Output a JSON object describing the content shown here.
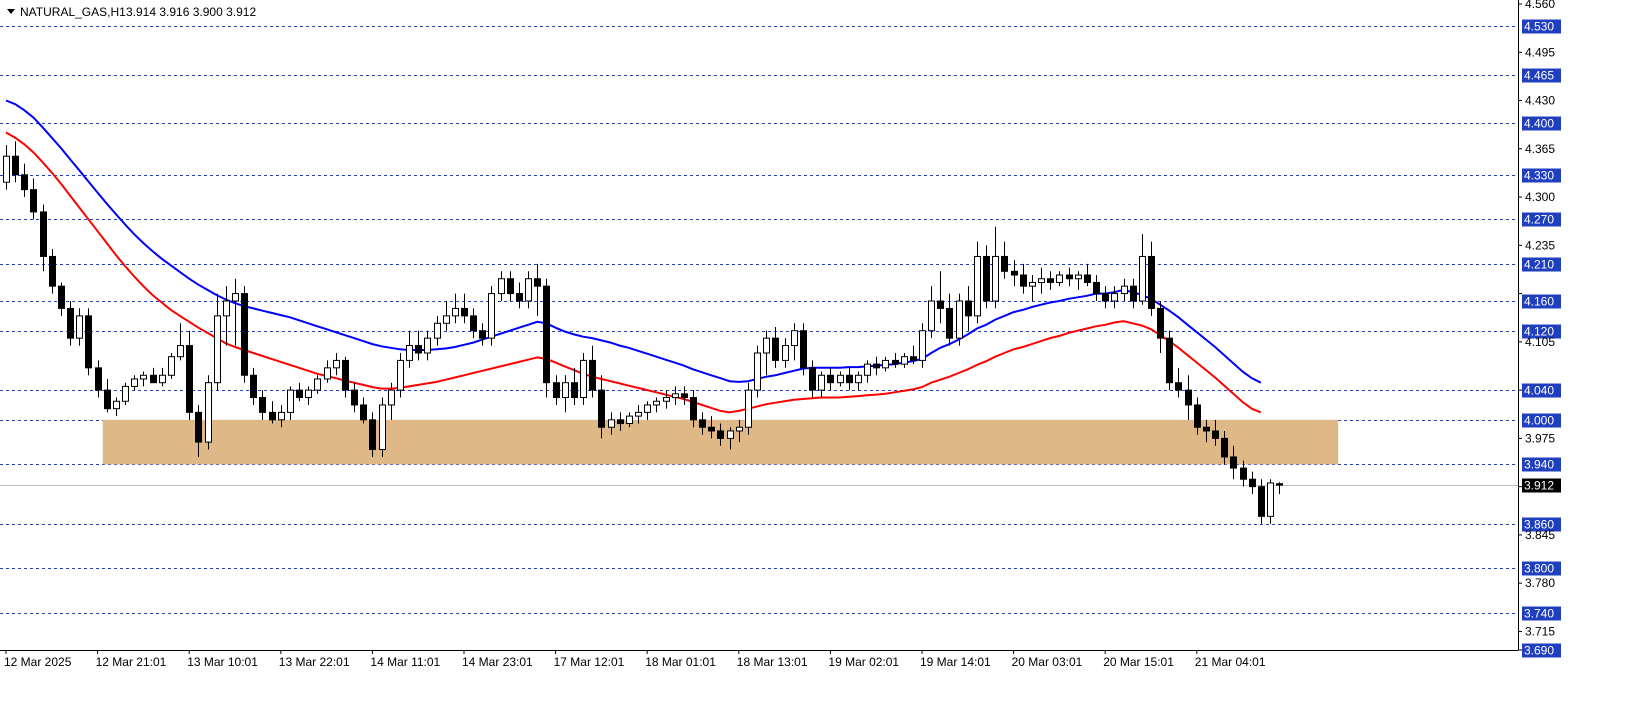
{
  "header": {
    "symbol": "NATURAL_GAS,H1",
    "ohlc": "3.914 3.916 3.900 3.912"
  },
  "colors": {
    "background": "#ffffff",
    "grid_level": "#1f3fbf",
    "badge": "#1f3fbf",
    "zone": "#deb887",
    "ma_fast": "#ff0000",
    "ma_slow": "#0000ff",
    "current_badge": "#000000"
  },
  "chart_data": {
    "type": "candlestick",
    "ylim": [
      3.69,
      4.56
    ],
    "y_ticks": [
      "4.560",
      "4.495",
      "4.430",
      "4.365",
      "4.300",
      "4.235",
      "4.170",
      "4.105",
      "4.040",
      "3.975",
      "3.910",
      "3.845",
      "3.780",
      "3.715",
      "3.690"
    ],
    "levels": [
      "4.530",
      "4.465",
      "4.400",
      "4.330",
      "4.270",
      "4.210",
      "4.160",
      "4.120",
      "4.040",
      "4.000",
      "3.940",
      "3.860",
      "3.800",
      "3.740",
      "3.690"
    ],
    "current_price": "3.912",
    "zone": {
      "from_bar": 11,
      "to_bar": 145,
      "low": 3.94,
      "high": 4.0
    },
    "x_labels": [
      {
        "bar": 0,
        "label": "12 Mar 2025"
      },
      {
        "bar": 10,
        "label": "12 Mar 21:01"
      },
      {
        "bar": 20,
        "label": "13 Mar 10:01"
      },
      {
        "bar": 30,
        "label": "13 Mar 22:01"
      },
      {
        "bar": 40,
        "label": "14 Mar 11:01"
      },
      {
        "bar": 50,
        "label": "14 Mar 23:01"
      },
      {
        "bar": 60,
        "label": "17 Mar 12:01"
      },
      {
        "bar": 70,
        "label": "18 Mar 01:01"
      },
      {
        "bar": 80,
        "label": "18 Mar 13:01"
      },
      {
        "bar": 90,
        "label": "19 Mar 02:01"
      },
      {
        "bar": 100,
        "label": "19 Mar 14:01"
      },
      {
        "bar": 110,
        "label": "20 Mar 03:01"
      },
      {
        "bar": 120,
        "label": "20 Mar 15:01"
      },
      {
        "bar": 130,
        "label": "21 Mar 04:01"
      }
    ],
    "candles": [
      [
        4.32,
        4.37,
        4.31,
        4.355
      ],
      [
        4.355,
        4.375,
        4.32,
        4.33
      ],
      [
        4.33,
        4.345,
        4.3,
        4.31
      ],
      [
        4.31,
        4.325,
        4.27,
        4.28
      ],
      [
        4.28,
        4.29,
        4.2,
        4.22
      ],
      [
        4.22,
        4.23,
        4.17,
        4.18
      ],
      [
        4.18,
        4.185,
        4.14,
        4.15
      ],
      [
        4.15,
        4.16,
        4.1,
        4.11
      ],
      [
        4.11,
        4.15,
        4.1,
        4.14
      ],
      [
        4.14,
        4.15,
        4.06,
        4.07
      ],
      [
        4.07,
        4.08,
        4.03,
        4.04
      ],
      [
        4.04,
        4.055,
        4.01,
        4.015
      ],
      [
        4.015,
        4.03,
        4.005,
        4.025
      ],
      [
        4.025,
        4.05,
        4.02,
        4.045
      ],
      [
        4.045,
        4.06,
        4.04,
        4.055
      ],
      [
        4.055,
        4.065,
        4.045,
        4.06
      ],
      [
        4.06,
        4.07,
        4.05,
        4.05
      ],
      [
        4.05,
        4.07,
        4.045,
        4.06
      ],
      [
        4.06,
        4.09,
        4.055,
        4.085
      ],
      [
        4.085,
        4.13,
        4.08,
        4.1
      ],
      [
        4.1,
        4.12,
        4.0,
        4.01
      ],
      [
        4.01,
        4.02,
        3.95,
        3.97
      ],
      [
        3.97,
        4.06,
        3.96,
        4.05
      ],
      [
        4.05,
        4.17,
        4.04,
        4.14
      ],
      [
        4.14,
        4.18,
        4.1,
        4.16
      ],
      [
        4.16,
        4.19,
        4.1,
        4.17
      ],
      [
        4.17,
        4.18,
        4.05,
        4.06
      ],
      [
        4.06,
        4.07,
        4.02,
        4.03
      ],
      [
        4.03,
        4.04,
        4.0,
        4.01
      ],
      [
        4.01,
        4.025,
        3.995,
        4.0
      ],
      [
        4.0,
        4.02,
        3.99,
        4.01
      ],
      [
        4.01,
        4.045,
        4.0,
        4.04
      ],
      [
        4.04,
        4.05,
        4.025,
        4.03
      ],
      [
        4.03,
        4.045,
        4.02,
        4.04
      ],
      [
        4.04,
        4.06,
        4.035,
        4.055
      ],
      [
        4.055,
        4.08,
        4.05,
        4.07
      ],
      [
        4.07,
        4.09,
        4.06,
        4.08
      ],
      [
        4.08,
        4.085,
        4.03,
        4.04
      ],
      [
        4.04,
        4.05,
        4.01,
        4.02
      ],
      [
        4.02,
        4.03,
        3.995,
        4.0
      ],
      [
        4.0,
        4.01,
        3.95,
        3.96
      ],
      [
        3.96,
        4.03,
        3.95,
        4.02
      ],
      [
        4.02,
        4.05,
        4.0,
        4.04
      ],
      [
        4.04,
        4.09,
        4.03,
        4.08
      ],
      [
        4.08,
        4.12,
        4.07,
        4.1
      ],
      [
        4.1,
        4.12,
        4.08,
        4.09
      ],
      [
        4.09,
        4.12,
        4.08,
        4.11
      ],
      [
        4.11,
        4.14,
        4.1,
        4.13
      ],
      [
        4.13,
        4.16,
        4.12,
        4.14
      ],
      [
        4.14,
        4.17,
        4.13,
        4.15
      ],
      [
        4.15,
        4.17,
        4.13,
        4.14
      ],
      [
        4.14,
        4.15,
        4.11,
        4.12
      ],
      [
        4.12,
        4.13,
        4.1,
        4.11
      ],
      [
        4.11,
        4.18,
        4.1,
        4.17
      ],
      [
        4.17,
        4.2,
        4.16,
        4.19
      ],
      [
        4.19,
        4.2,
        4.16,
        4.17
      ],
      [
        4.17,
        4.185,
        4.15,
        4.16
      ],
      [
        4.16,
        4.2,
        4.15,
        4.19
      ],
      [
        4.19,
        4.21,
        4.14,
        4.18
      ],
      [
        4.18,
        4.19,
        4.03,
        4.05
      ],
      [
        4.05,
        4.06,
        4.02,
        4.03
      ],
      [
        4.03,
        4.06,
        4.01,
        4.05
      ],
      [
        4.05,
        4.07,
        4.02,
        4.03
      ],
      [
        4.03,
        4.09,
        4.02,
        4.08
      ],
      [
        4.08,
        4.1,
        4.03,
        4.04
      ],
      [
        4.04,
        4.06,
        3.975,
        3.99
      ],
      [
        3.99,
        4.01,
        3.98,
        4.0
      ],
      [
        4.0,
        4.01,
        3.985,
        3.995
      ],
      [
        3.995,
        4.01,
        3.99,
        4.005
      ],
      [
        4.005,
        4.02,
        3.995,
        4.01
      ],
      [
        4.01,
        4.025,
        4.0,
        4.02
      ],
      [
        4.02,
        4.03,
        4.01,
        4.025
      ],
      [
        4.025,
        4.04,
        4.015,
        4.03
      ],
      [
        4.03,
        4.045,
        4.02,
        4.035
      ],
      [
        4.035,
        4.045,
        4.02,
        4.03
      ],
      [
        4.03,
        4.04,
        3.99,
        4.0
      ],
      [
        4.0,
        4.01,
        3.98,
        3.99
      ],
      [
        3.99,
        4.005,
        3.975,
        3.985
      ],
      [
        3.985,
        3.995,
        3.965,
        3.975
      ],
      [
        3.975,
        3.99,
        3.96,
        3.985
      ],
      [
        3.985,
        4.0,
        3.97,
        3.99
      ],
      [
        3.99,
        4.05,
        3.98,
        4.04
      ],
      [
        4.04,
        4.1,
        4.03,
        4.09
      ],
      [
        4.09,
        4.12,
        4.06,
        4.11
      ],
      [
        4.11,
        4.125,
        4.07,
        4.08
      ],
      [
        4.08,
        4.11,
        4.07,
        4.1
      ],
      [
        4.1,
        4.13,
        4.08,
        4.12
      ],
      [
        4.12,
        4.13,
        4.06,
        4.07
      ],
      [
        4.07,
        4.08,
        4.03,
        4.04
      ],
      [
        4.04,
        4.065,
        4.03,
        4.06
      ],
      [
        4.06,
        4.07,
        4.04,
        4.05
      ],
      [
        4.05,
        4.065,
        4.045,
        4.06
      ],
      [
        4.06,
        4.07,
        4.04,
        4.05
      ],
      [
        4.05,
        4.065,
        4.04,
        4.06
      ],
      [
        4.06,
        4.08,
        4.05,
        4.075
      ],
      [
        4.075,
        4.085,
        4.06,
        4.07
      ],
      [
        4.07,
        4.085,
        4.065,
        4.08
      ],
      [
        4.08,
        4.09,
        4.07,
        4.075
      ],
      [
        4.075,
        4.09,
        4.07,
        4.085
      ],
      [
        4.085,
        4.1,
        4.075,
        4.08
      ],
      [
        4.08,
        4.13,
        4.07,
        4.12
      ],
      [
        4.12,
        4.18,
        4.11,
        4.16
      ],
      [
        4.16,
        4.2,
        4.13,
        4.15
      ],
      [
        4.15,
        4.17,
        4.1,
        4.11
      ],
      [
        4.11,
        4.17,
        4.1,
        4.16
      ],
      [
        4.16,
        4.18,
        4.12,
        4.14
      ],
      [
        4.14,
        4.24,
        4.13,
        4.22
      ],
      [
        4.22,
        4.235,
        4.15,
        4.16
      ],
      [
        4.16,
        4.26,
        4.15,
        4.22
      ],
      [
        4.22,
        4.24,
        4.19,
        4.2
      ],
      [
        4.2,
        4.215,
        4.18,
        4.195
      ],
      [
        4.195,
        4.21,
        4.17,
        4.18
      ],
      [
        4.18,
        4.195,
        4.16,
        4.185
      ],
      [
        4.185,
        4.205,
        4.17,
        4.19
      ],
      [
        4.19,
        4.2,
        4.175,
        4.185
      ],
      [
        4.185,
        4.2,
        4.18,
        4.195
      ],
      [
        4.195,
        4.205,
        4.18,
        4.19
      ],
      [
        4.19,
        4.2,
        4.175,
        4.195
      ],
      [
        4.195,
        4.21,
        4.18,
        4.185
      ],
      [
        4.185,
        4.195,
        4.16,
        4.17
      ],
      [
        4.17,
        4.18,
        4.15,
        4.16
      ],
      [
        4.16,
        4.18,
        4.15,
        4.17
      ],
      [
        4.17,
        4.19,
        4.16,
        4.18
      ],
      [
        4.18,
        4.19,
        4.15,
        4.16
      ],
      [
        4.16,
        4.25,
        4.155,
        4.22
      ],
      [
        4.22,
        4.24,
        4.14,
        4.15
      ],
      [
        4.15,
        4.16,
        4.09,
        4.11
      ],
      [
        4.11,
        4.12,
        4.04,
        4.05
      ],
      [
        4.05,
        4.07,
        4.03,
        4.04
      ],
      [
        4.04,
        4.06,
        4.0,
        4.02
      ],
      [
        4.02,
        4.03,
        3.98,
        3.99
      ],
      [
        3.99,
        4.0,
        3.97,
        3.985
      ],
      [
        3.985,
        4.0,
        3.965,
        3.975
      ],
      [
        3.975,
        3.985,
        3.94,
        3.95
      ],
      [
        3.95,
        3.965,
        3.92,
        3.935
      ],
      [
        3.935,
        3.945,
        3.91,
        3.92
      ],
      [
        3.92,
        3.93,
        3.9,
        3.91
      ],
      [
        3.91,
        3.92,
        3.86,
        3.87
      ],
      [
        3.87,
        3.92,
        3.86,
        3.915
      ],
      [
        3.914,
        3.916,
        3.9,
        3.912
      ]
    ],
    "ma_slow": [
      4.43,
      4.425,
      4.417,
      4.407,
      4.394,
      4.38,
      4.366,
      4.351,
      4.336,
      4.321,
      4.306,
      4.291,
      4.277,
      4.263,
      4.25,
      4.238,
      4.227,
      4.217,
      4.208,
      4.199,
      4.19,
      4.182,
      4.175,
      4.168,
      4.162,
      4.157,
      4.153,
      4.15,
      4.147,
      4.144,
      4.141,
      4.138,
      4.134,
      4.13,
      4.126,
      4.122,
      4.118,
      4.114,
      4.11,
      4.106,
      4.102,
      4.099,
      4.097,
      4.095,
      4.094,
      4.094,
      4.094,
      4.095,
      4.096,
      4.098,
      4.101,
      4.104,
      4.108,
      4.112,
      4.116,
      4.12,
      4.124,
      4.128,
      4.132,
      4.13,
      4.124,
      4.119,
      4.115,
      4.112,
      4.11,
      4.107,
      4.104,
      4.1,
      4.097,
      4.093,
      4.089,
      4.085,
      4.081,
      4.077,
      4.073,
      4.068,
      4.064,
      4.06,
      4.056,
      4.052,
      4.051,
      4.052,
      4.055,
      4.058,
      4.06,
      4.063,
      4.066,
      4.069,
      4.07,
      4.07,
      4.07,
      4.07,
      4.071,
      4.071,
      4.072,
      4.073,
      4.074,
      4.075,
      4.077,
      4.079,
      4.082,
      4.09,
      4.097,
      4.102,
      4.108,
      4.115,
      4.123,
      4.128,
      4.135,
      4.14,
      4.145,
      4.148,
      4.152,
      4.155,
      4.158,
      4.16,
      4.163,
      4.165,
      4.167,
      4.17,
      4.17,
      4.172,
      4.175,
      4.172,
      4.168,
      4.163,
      4.155,
      4.147,
      4.138,
      4.128,
      4.118,
      4.108,
      4.098,
      4.087,
      4.076,
      4.065,
      4.056,
      4.05
    ],
    "ma_fast": [
      4.387,
      4.38,
      4.371,
      4.36,
      4.347,
      4.333,
      4.318,
      4.302,
      4.286,
      4.27,
      4.254,
      4.238,
      4.222,
      4.207,
      4.193,
      4.18,
      4.168,
      4.158,
      4.148,
      4.14,
      4.132,
      4.124,
      4.117,
      4.11,
      4.103,
      4.098,
      4.094,
      4.09,
      4.086,
      4.082,
      4.078,
      4.074,
      4.07,
      4.066,
      4.062,
      4.059,
      4.056,
      4.053,
      4.05,
      4.047,
      4.044,
      4.042,
      4.042,
      4.043,
      4.045,
      4.047,
      4.049,
      4.051,
      4.054,
      4.057,
      4.06,
      4.063,
      4.066,
      4.069,
      4.072,
      4.075,
      4.078,
      4.081,
      4.084,
      4.082,
      4.077,
      4.072,
      4.067,
      4.062,
      4.058,
      4.055,
      4.052,
      4.049,
      4.046,
      4.043,
      4.04,
      4.037,
      4.034,
      4.031,
      4.028,
      4.024,
      4.02,
      4.016,
      4.012,
      4.01,
      4.012,
      4.015,
      4.018,
      4.021,
      4.023,
      4.025,
      4.027,
      4.028,
      4.029,
      4.03,
      4.03,
      4.03,
      4.031,
      4.032,
      4.033,
      4.034,
      4.035,
      4.037,
      4.039,
      4.041,
      4.044,
      4.05,
      4.054,
      4.058,
      4.063,
      4.068,
      4.074,
      4.079,
      4.085,
      4.09,
      4.095,
      4.098,
      4.102,
      4.106,
      4.11,
      4.113,
      4.117,
      4.12,
      4.123,
      4.126,
      4.128,
      4.131,
      4.133,
      4.13,
      4.127,
      4.122,
      4.114,
      4.106,
      4.097,
      4.087,
      4.077,
      4.067,
      4.057,
      4.046,
      4.035,
      4.024,
      4.015,
      4.01
    ]
  }
}
